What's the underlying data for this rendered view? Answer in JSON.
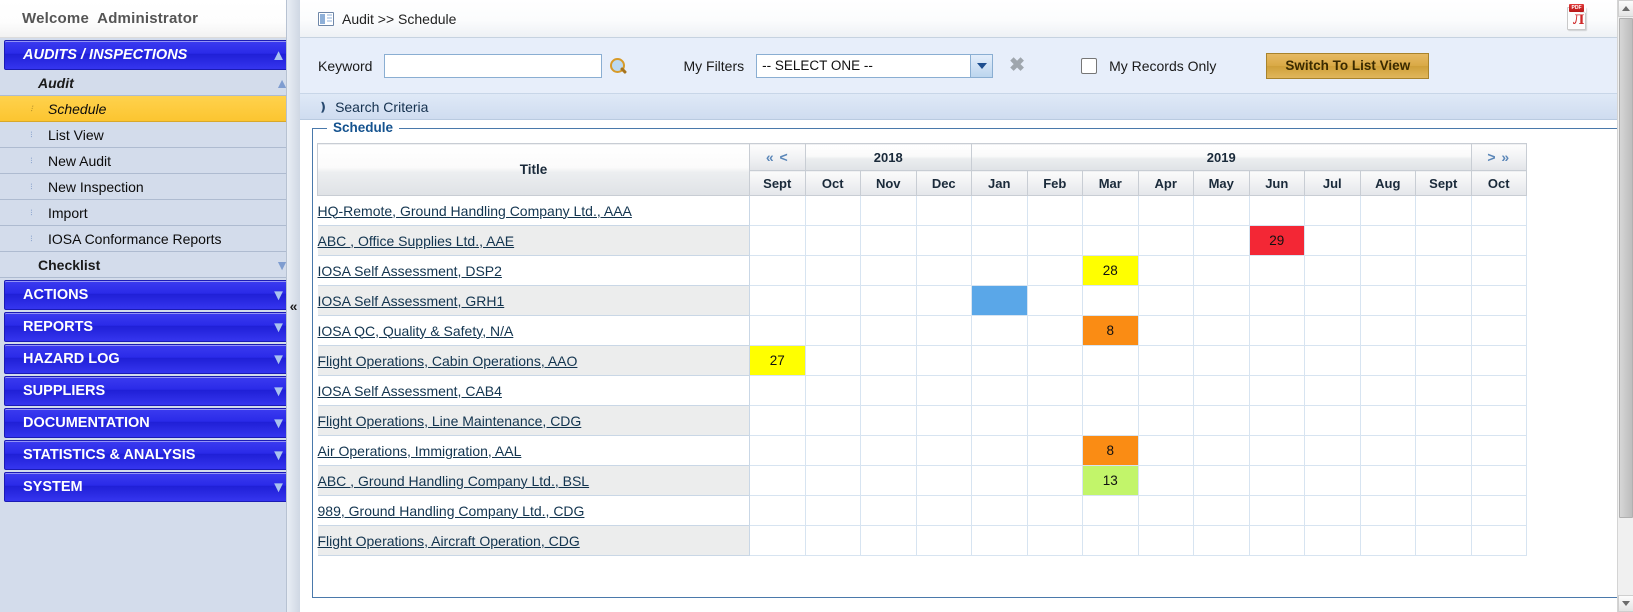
{
  "sidebar": {
    "welcome": "Welcome  Administrator",
    "main_section": {
      "label": "AUDITS / INSPECTIONS",
      "chevron": "chevron-up"
    },
    "groups": [
      {
        "label": "Audit",
        "chevron": "chevron-up"
      },
      {
        "label": "Checklist",
        "chevron": "chevron-down"
      }
    ],
    "audit_items": [
      {
        "label": "Schedule",
        "active": true
      },
      {
        "label": "List View",
        "active": false
      },
      {
        "label": "New Audit",
        "active": false
      },
      {
        "label": "New Inspection",
        "active": false
      },
      {
        "label": "Import",
        "active": false
      },
      {
        "label": "IOSA Conformance Reports",
        "active": false
      }
    ],
    "sections": [
      {
        "label": "ACTIONS"
      },
      {
        "label": "REPORTS"
      },
      {
        "label": "HAZARD LOG"
      },
      {
        "label": "SUPPLIERS"
      },
      {
        "label": "DOCUMENTATION"
      },
      {
        "label": "STATISTICS & ANALYSIS"
      },
      {
        "label": "SYSTEM"
      }
    ],
    "collapse_arrow": "«"
  },
  "header": {
    "breadcrumb": "Audit >> Schedule",
    "breadcrumb_icon": "report-icon",
    "export_icon": "pdf-export-icon"
  },
  "toolbar": {
    "keyword_label": "Keyword",
    "keyword_value": "",
    "keyword_placeholder": "",
    "search_icon": "magnifier-icon",
    "my_filters_label": "My Filters",
    "my_filters_value": "-- SELECT ONE --",
    "my_filters_options": [
      "-- SELECT ONE --"
    ],
    "clear_icon": "clear-filter-icon",
    "my_records_label": "My Records Only",
    "my_records_checked": false,
    "switch_button": "Switch To List View"
  },
  "search_criteria": {
    "label": "Search Criteria",
    "chevron": "chevron-double-down"
  },
  "schedule": {
    "legend": "Schedule",
    "title_column": "Title",
    "nav_prev_all": "«",
    "nav_prev": "<",
    "nav_next": ">",
    "nav_next_all": "»",
    "years": [
      {
        "label": "2018",
        "span": 4
      },
      {
        "label": "2019",
        "span": 10
      }
    ],
    "months": [
      "Sept",
      "Oct",
      "Nov",
      "Dec",
      "Jan",
      "Feb",
      "Mar",
      "Apr",
      "May",
      "Jun",
      "Jul",
      "Aug",
      "Sept",
      "Oct"
    ],
    "rows": [
      {
        "title": "HQ-Remote, Ground Handling Company Ltd., AAA",
        "entries": []
      },
      {
        "title": "ABC , Office Supplies Ltd., AAE",
        "entries": [
          {
            "month": "Jun",
            "index": 9,
            "value": "29",
            "color": "#f32735"
          }
        ]
      },
      {
        "title": "IOSA Self Assessment, DSP2",
        "entries": [
          {
            "month": "Mar",
            "index": 6,
            "value": "28",
            "color": "#ffff00"
          }
        ]
      },
      {
        "title": "IOSA Self Assessment, GRH1",
        "entries": [
          {
            "month": "Jan",
            "index": 4,
            "value": "",
            "color": "#5aa7e8"
          }
        ]
      },
      {
        "title": "IOSA QC, Quality & Safety, N/A",
        "entries": [
          {
            "month": "Mar",
            "index": 6,
            "value": "8",
            "color": "#fa8c14"
          }
        ]
      },
      {
        "title": "Flight Operations, Cabin Operations, AAO",
        "entries": [
          {
            "month": "Sept",
            "index": 0,
            "value": "27",
            "color": "#ffff00"
          }
        ]
      },
      {
        "title": "IOSA Self Assessment, CAB4",
        "entries": []
      },
      {
        "title": "Flight Operations, Line Maintenance, CDG",
        "entries": []
      },
      {
        "title": "Air Operations, Immigration, AAL",
        "entries": [
          {
            "month": "Mar",
            "index": 6,
            "value": "8",
            "color": "#fa8c14"
          }
        ]
      },
      {
        "title": "ABC , Ground Handling Company Ltd., BSL",
        "entries": [
          {
            "month": "Mar",
            "index": 6,
            "value": "13",
            "color": "#c2f56a"
          }
        ]
      },
      {
        "title": "989, Ground Handling Company Ltd., CDG",
        "entries": []
      },
      {
        "title": "Flight Operations, Aircraft Operation, CDG",
        "entries": []
      }
    ]
  },
  "colors": {
    "nav_blue": "#2a2ae8",
    "active_gold": "#fcc530",
    "accent_button": "#d9a945",
    "link": "#12344f"
  }
}
